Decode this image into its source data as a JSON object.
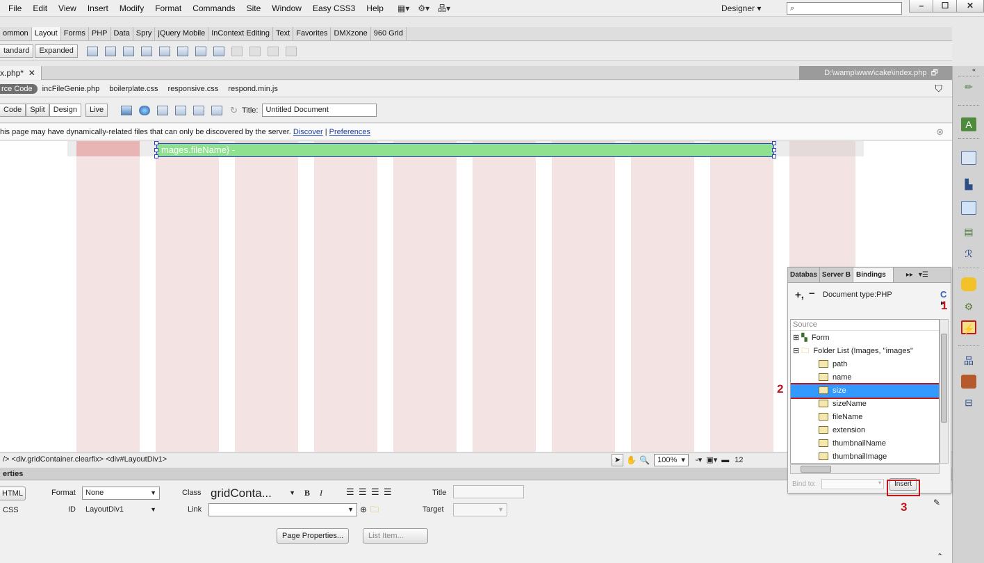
{
  "menubar": {
    "items": [
      "File",
      "Edit",
      "View",
      "Insert",
      "Modify",
      "Format",
      "Commands",
      "Site",
      "Window",
      "Easy CSS3",
      "Help"
    ],
    "workspace": "Designer",
    "search_placeholder": ""
  },
  "insert_tabs": [
    "ommon",
    "Layout",
    "Forms",
    "PHP",
    "Data",
    "Spry",
    "jQuery Mobile",
    "InContext Editing",
    "Text",
    "Favorites",
    "DMXzone",
    "960 Grid"
  ],
  "layout_bar": {
    "standard": "tandard",
    "expanded": "Expanded"
  },
  "document": {
    "tab": "x.php*",
    "path": "D:\\wamp\\www\\cake\\index.php",
    "source_code": "rce Code",
    "related_files": [
      "incFileGenie.php",
      "boilerplate.css",
      "responsive.css",
      "respond.min.js"
    ],
    "views": [
      "Code",
      "Split",
      "Design",
      "Live"
    ],
    "title_label": "Title:",
    "title_value": "Untitled Document",
    "info_text": "his page may have dynamically-related files that can only be discovered by the server. ",
    "info_discover": "Discover",
    "info_sep": " | ",
    "info_prefs": "Preferences",
    "binding_text": "mages.fileName} -"
  },
  "tag_selector": {
    "path": "/> <div.gridContainer.clearfix> <div#LayoutDiv1>",
    "zoom": "100%",
    "size": "12"
  },
  "properties": {
    "header": "erties",
    "html_btn": "HTML",
    "css_btn": "CSS",
    "format_label": "Format",
    "format_value": "None",
    "id_label": "ID",
    "id_value": "LayoutDiv1",
    "class_label": "Class",
    "class_value": "gridConta...",
    "link_label": "Link",
    "title_label": "Title",
    "target_label": "Target",
    "page_props": "Page Properties...",
    "list_item": "List Item..."
  },
  "bindings": {
    "tabs": [
      "Databas",
      "Server B",
      "Bindings"
    ],
    "doc_type": "Document type:PHP",
    "source_header": "Source",
    "form": "Form",
    "folder": "Folder List (Images, \"images\"",
    "fields": [
      "path",
      "name",
      "size",
      "sizeName",
      "fileName",
      "extension",
      "thumbnailName",
      "thumbnailImage"
    ],
    "selected_field": "size",
    "bind_to": "Bind to:",
    "insert": "Insert"
  },
  "callouts": [
    "1",
    "2",
    "3"
  ],
  "colors": {
    "selection": "#3399ff",
    "callout_red": "#c0161e",
    "binding_green": "#8fe08f",
    "grid_pink": "#f3e3e3"
  }
}
